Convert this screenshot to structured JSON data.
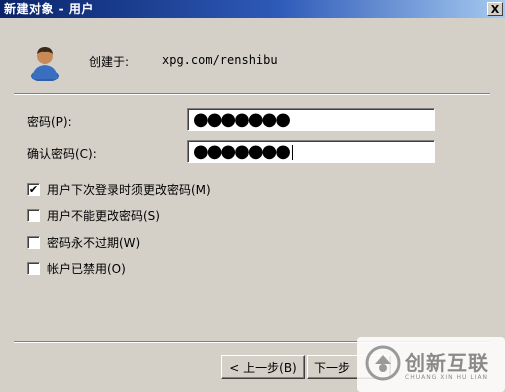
{
  "window": {
    "title": "新建对象 - 用户",
    "close_label": "X"
  },
  "header": {
    "created_label": "创建于:",
    "created_value": "xpg.com/renshibu",
    "icon": "user-icon"
  },
  "fields": {
    "password_label": "密码(P):",
    "password_value": "●●●●●●●",
    "confirm_label": "确认密码(C):",
    "confirm_value": "●●●●●●●"
  },
  "options": [
    {
      "label": "用户下次登录时须更改密码(M)",
      "checked": true
    },
    {
      "label": "用户不能更改密码(S)",
      "checked": false
    },
    {
      "label": "密码永不过期(W)",
      "checked": false
    },
    {
      "label": "帐户已禁用(O)",
      "checked": false
    }
  ],
  "buttons": {
    "back_label": "< 上一步(B)",
    "next_label": "下一步"
  },
  "watermark": {
    "text": "创新互联",
    "subtext": "CHUANG XIN HU LIAN"
  },
  "colors": {
    "titlebar_start": "#0a246a",
    "titlebar_end": "#a6caf0",
    "dialog_bg": "#d4d0c8"
  }
}
